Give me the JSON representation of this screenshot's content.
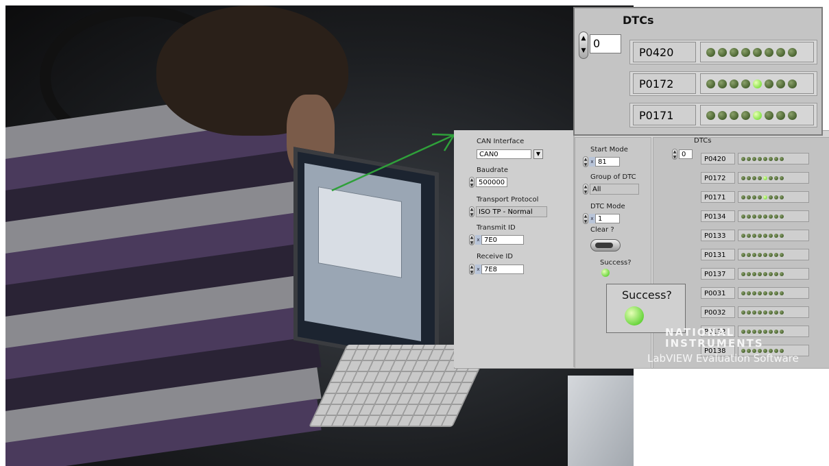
{
  "colors": {
    "led_on": "#5bd11c",
    "led_off": "#2e4a18",
    "arrow": "#2fa03a",
    "panel_bg": "#d4d4d4"
  },
  "icons": {
    "spinner": "spinner-arrows-icon",
    "dropdown": "dropdown-arrow-icon",
    "led": "led-indicator-icon",
    "arrow": "green-arrow-icon"
  },
  "left_column": {
    "can_interface_label": "CAN Interface",
    "can_interface_value": "CAN0",
    "baudrate_label": "Baudrate",
    "baudrate_value": "500000",
    "transport_label": "Transport Protocol",
    "transport_value": "ISO TP - Normal",
    "transmit_label": "Transmit ID",
    "transmit_value": "7E0",
    "receive_label": "Receive ID",
    "receive_value": "7E8",
    "hex_prefix": "x"
  },
  "middle_column": {
    "start_mode_label": "Start Mode",
    "start_mode_value": "81",
    "group_label": "Group of DTC",
    "group_value": "All",
    "dtc_mode_label": "DTC Mode",
    "dtc_mode_value": "1",
    "clear_label": "Clear ?",
    "success_label": "Success?",
    "success_on": true,
    "hex_prefix": "x"
  },
  "dtc_panel": {
    "title": "DTCs",
    "index": "0",
    "rows": [
      {
        "code": "P0420",
        "lit": -1
      },
      {
        "code": "P0172",
        "lit": 4
      },
      {
        "code": "P0171",
        "lit": 4
      },
      {
        "code": "P0134",
        "lit": -1
      },
      {
        "code": "P0133",
        "lit": -1
      },
      {
        "code": "P0131",
        "lit": -1
      },
      {
        "code": "P0137",
        "lit": -1
      },
      {
        "code": "P0031",
        "lit": -1
      },
      {
        "code": "P0032",
        "lit": -1
      },
      {
        "code": "P0132",
        "lit": -1
      },
      {
        "code": "P0138",
        "lit": -1
      }
    ]
  },
  "zoom_dtc": {
    "title": "DTCs",
    "index": "0",
    "rows": [
      {
        "code": "P0420",
        "lit": -1
      },
      {
        "code": "P0172",
        "lit": 4
      },
      {
        "code": "P0171",
        "lit": 4
      }
    ]
  },
  "zoom_success": {
    "label": "Success?",
    "on": true
  },
  "watermark": {
    "line1": "NATIONAL",
    "line2": "INSTRUMENTS",
    "line3": "LabVIEW Evaluation Software"
  }
}
